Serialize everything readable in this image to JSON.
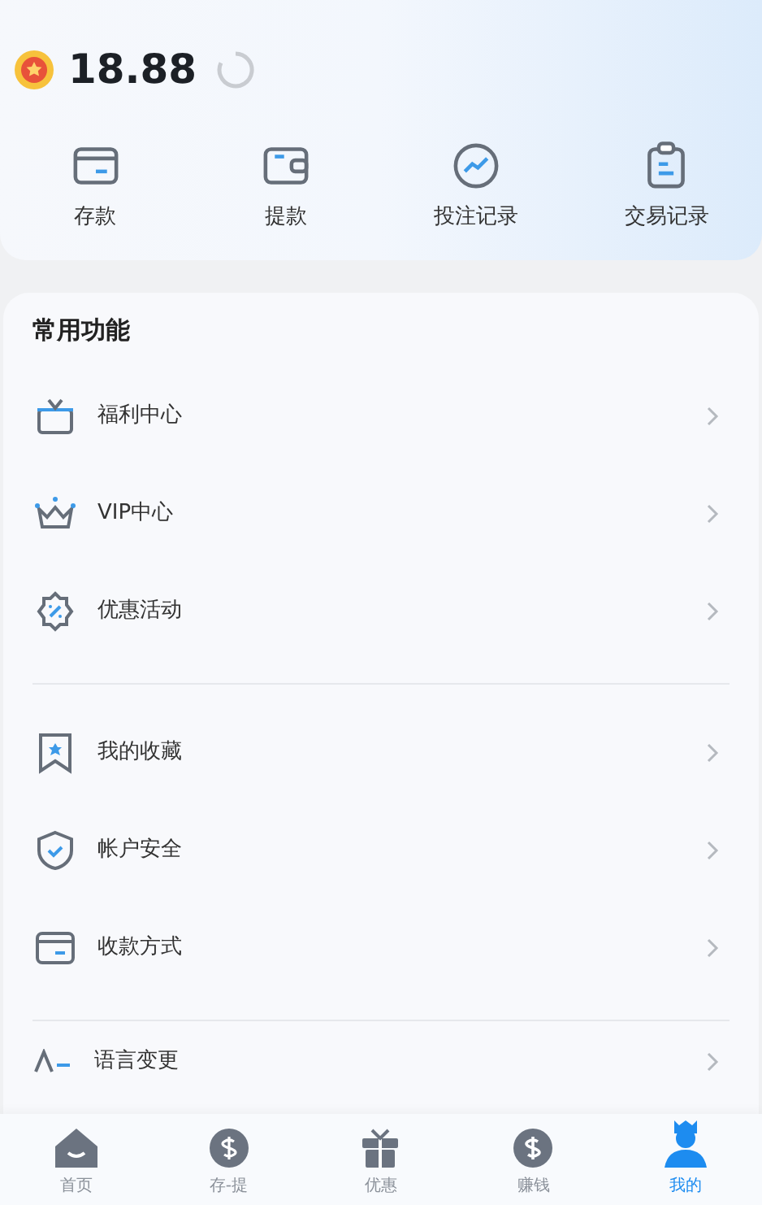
{
  "balance": {
    "amount": "18.88"
  },
  "actions": [
    {
      "label": "存款"
    },
    {
      "label": "提款"
    },
    {
      "label": "投注记录"
    },
    {
      "label": "交易记录"
    }
  ],
  "section": {
    "title": "常用功能"
  },
  "groups": [
    [
      {
        "label": "福利中心"
      },
      {
        "label": "VIP中心"
      },
      {
        "label": "优惠活动"
      }
    ],
    [
      {
        "label": "我的收藏"
      },
      {
        "label": "帐户安全"
      },
      {
        "label": "收款方式"
      }
    ],
    [
      {
        "label": "语言变更"
      }
    ]
  ],
  "nav": [
    {
      "label": "首页",
      "selected": false
    },
    {
      "label": "存-提",
      "selected": false
    },
    {
      "label": "优惠",
      "selected": false
    },
    {
      "label": "赚钱",
      "selected": false
    },
    {
      "label": "我的",
      "selected": true
    }
  ]
}
